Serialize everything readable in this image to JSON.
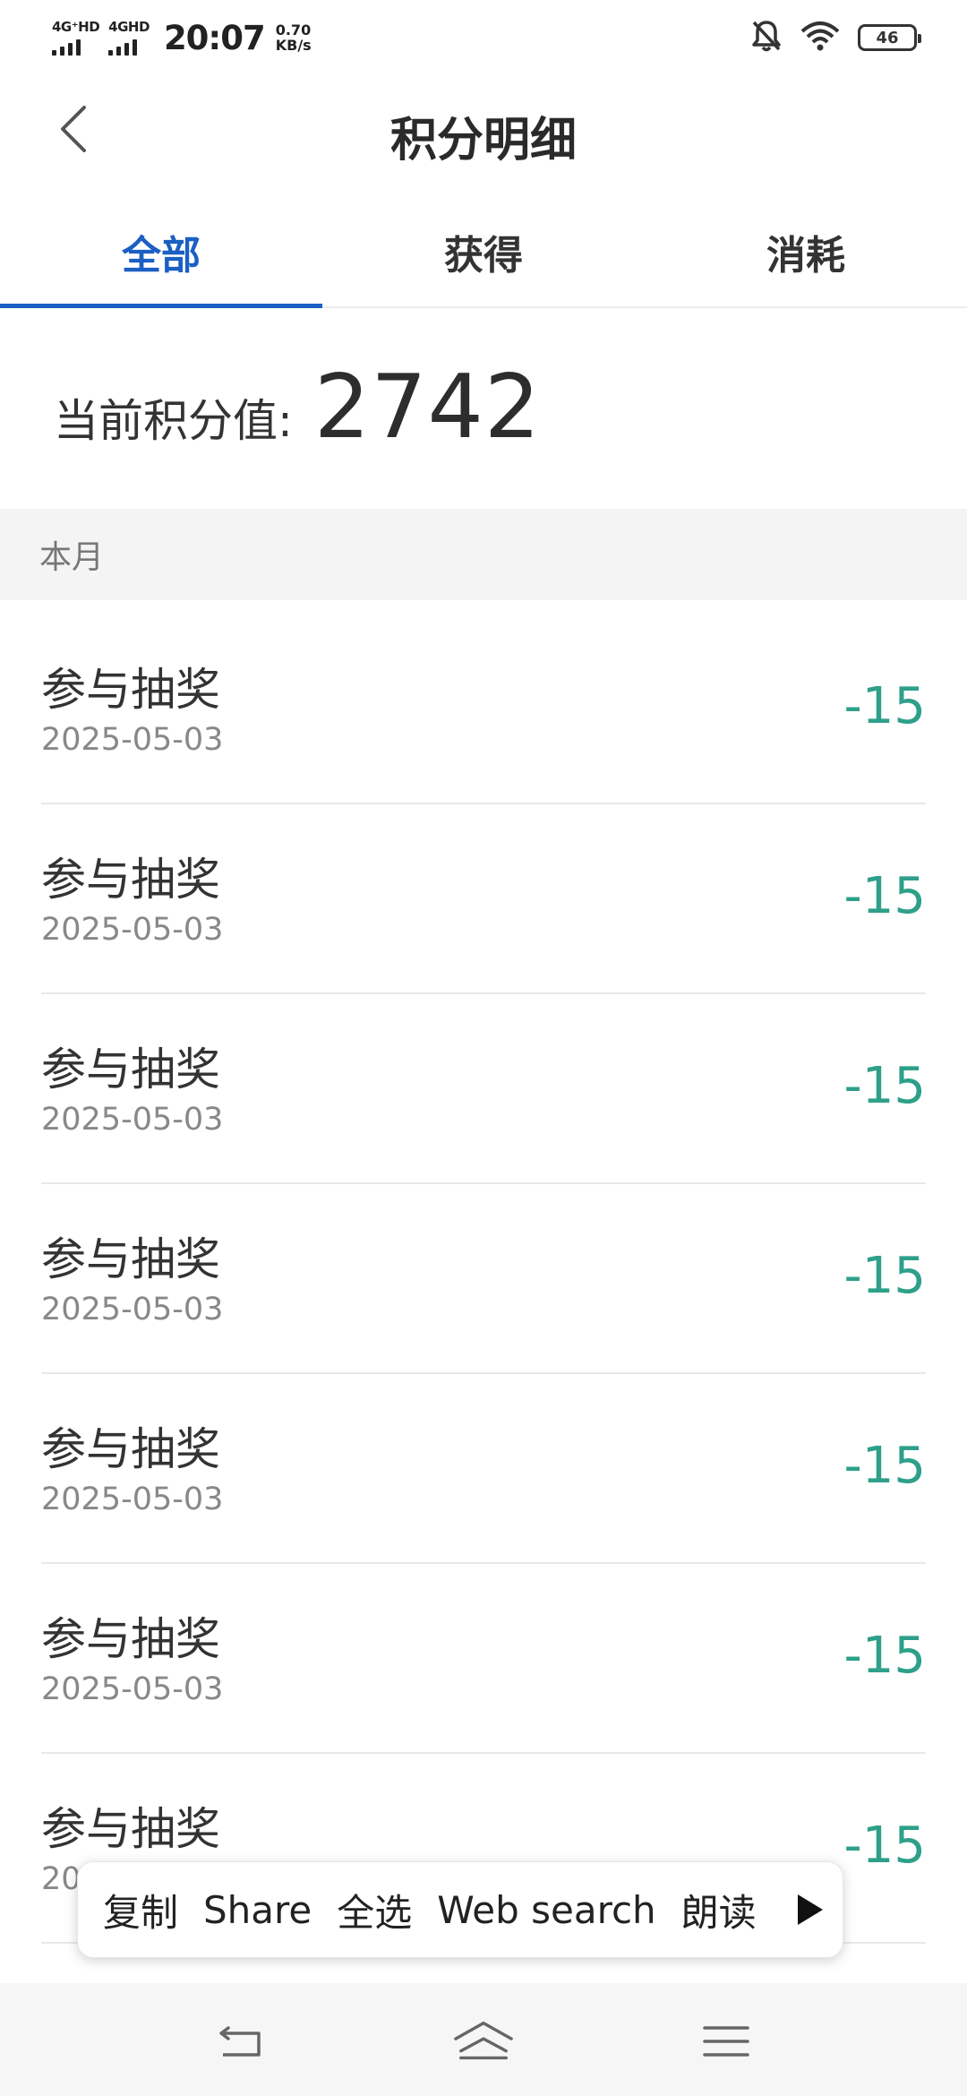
{
  "status_bar": {
    "sim1_label": "4G⁺HD",
    "sim2_label": "4GHD",
    "time": "20:07",
    "speed_value": "0.70",
    "speed_unit": "KB/s",
    "battery": "46"
  },
  "header": {
    "title": "积分明细"
  },
  "tabs": [
    {
      "label": "全部",
      "active": true
    },
    {
      "label": "获得",
      "active": false
    },
    {
      "label": "消耗",
      "active": false
    }
  ],
  "summary": {
    "label": "当前积分值:",
    "value": "2742"
  },
  "section": {
    "label": "本月"
  },
  "records": [
    {
      "title": "参与抽奖",
      "date": "2025-05-03",
      "amount": "-15"
    },
    {
      "title": "参与抽奖",
      "date": "2025-05-03",
      "amount": "-15"
    },
    {
      "title": "参与抽奖",
      "date": "2025-05-03",
      "amount": "-15"
    },
    {
      "title": "参与抽奖",
      "date": "2025-05-03",
      "amount": "-15"
    },
    {
      "title": "参与抽奖",
      "date": "2025-05-03",
      "amount": "-15"
    },
    {
      "title": "参与抽奖",
      "date": "2025-05-03",
      "amount": "-15"
    },
    {
      "title": "参与抽奖",
      "date": "20",
      "amount": "-15"
    }
  ],
  "context_menu": {
    "items": [
      "复制",
      "Share",
      "全选",
      "Web search",
      "朗读"
    ]
  },
  "colors": {
    "accent": "#1b5fc4",
    "amount": "#2ea08a",
    "section_bg": "#f4f4f4"
  }
}
